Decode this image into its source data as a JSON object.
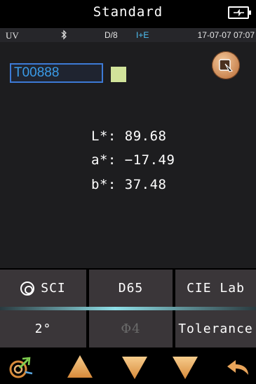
{
  "header": {
    "title": "Standard"
  },
  "status": {
    "light_source": "UV",
    "geometry": "D/8",
    "mode": "I+E",
    "datetime": "17-07-07 07:07"
  },
  "sample": {
    "name": "T00888",
    "swatch_color": "#d1e39a"
  },
  "readings": {
    "l_line": "L*: 89.68",
    "a_line": "a*: −17.49",
    "b_line": "b*: 37.48"
  },
  "buttons": {
    "sci": "SCI",
    "illuminant": "D65",
    "color_space": "CIE Lab",
    "observer": "2°",
    "phi4": "Φ4",
    "tolerance": "Tolerance"
  },
  "icons": {
    "battery": "battery-charging-icon",
    "bluetooth": "bluetooth-icon",
    "print": "print-icon",
    "measure": "target-measure-icon",
    "up": "arrow-up-icon",
    "down": "arrow-down-icon",
    "back": "back-arrow-icon"
  },
  "colors": {
    "accent_blue": "#3a9be8",
    "nav_orange": "#e8a45a",
    "button_bg": "#3a3639"
  }
}
